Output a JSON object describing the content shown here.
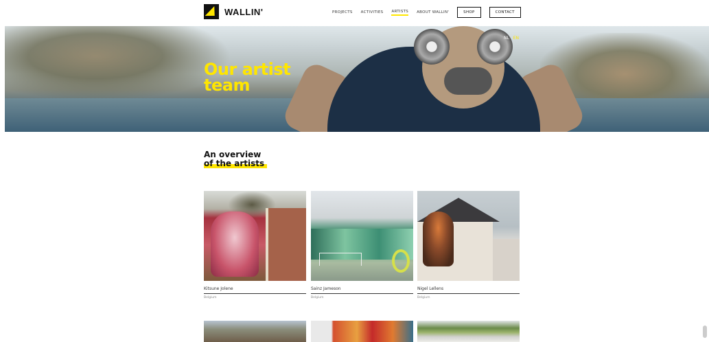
{
  "brand": {
    "name": "WALLIN'"
  },
  "nav": {
    "items": [
      "PROJECTS",
      "ACTIVITIES",
      "ARTISTS",
      "ABOUT WALLIN'"
    ],
    "active": "ARTISTS",
    "shop": "SHOP",
    "contact": "CONTACT"
  },
  "hero": {
    "title_line1": "Our artist",
    "title_line2": "team",
    "lang_nl": "NL",
    "lang_en": "EN"
  },
  "overview": {
    "line1": "An overview",
    "line2": "of the artists"
  },
  "artists": [
    {
      "name": "Kitsune Jolene",
      "country": "Belgium"
    },
    {
      "name": "Sainz Jameson",
      "country": "Belgium"
    },
    {
      "name": "Nigel Lellens",
      "country": "Belgium"
    }
  ],
  "colors": {
    "accent": "#ffe600",
    "text": "#111111"
  }
}
